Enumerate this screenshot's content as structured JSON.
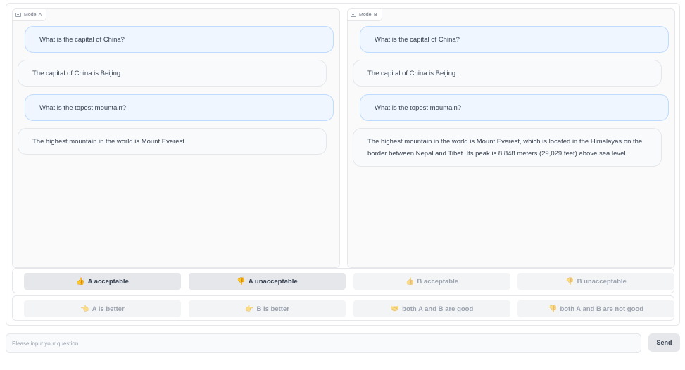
{
  "panels": {
    "a": {
      "label": "Model A",
      "messages": [
        {
          "role": "user",
          "text": "What is the capital of China?"
        },
        {
          "role": "assistant",
          "text": "The capital of China is Beijing."
        },
        {
          "role": "user",
          "text": "What is the topest mountain?"
        },
        {
          "role": "assistant",
          "text": "The highest mountain in the world is Mount Everest."
        }
      ]
    },
    "b": {
      "label": "Model B",
      "messages": [
        {
          "role": "user",
          "text": "What is the capital of China?"
        },
        {
          "role": "assistant",
          "text": "The capital of China is Beijing."
        },
        {
          "role": "user",
          "text": "What is the topest mountain?"
        },
        {
          "role": "assistant",
          "text_line1": "The highest mountain in the world is Mount Everest, which is located in the Himalayas on the",
          "text_line2": "border between Nepal and Tibet. Its peak is 8,848 meters (29,029 feet) above sea level."
        }
      ]
    }
  },
  "vote_row_1": [
    {
      "icon": "👍",
      "icon_name": "thumbs-up-icon",
      "label": "A acceptable",
      "enabled": true
    },
    {
      "icon": "👎",
      "icon_name": "thumbs-down-icon",
      "label": "A unacceptable",
      "enabled": true
    },
    {
      "icon": "👍",
      "icon_name": "thumbs-up-icon",
      "label": "B acceptable",
      "enabled": false
    },
    {
      "icon": "👎",
      "icon_name": "thumbs-down-icon",
      "label": "B unacceptable",
      "enabled": false
    }
  ],
  "vote_row_2": [
    {
      "icon": "👈",
      "icon_name": "pointing-left-icon",
      "label": "A is better",
      "enabled": false
    },
    {
      "icon": "👉",
      "icon_name": "pointing-right-icon",
      "label": "B is better",
      "enabled": false
    },
    {
      "icon": "🤝",
      "icon_name": "handshake-icon",
      "label": "both A and B are good",
      "enabled": false
    },
    {
      "icon": "👎",
      "icon_name": "thumbs-down-icon",
      "label": "both A and B are not good",
      "enabled": false
    }
  ],
  "input": {
    "placeholder": "Please input your question",
    "value": ""
  },
  "send_label": "Send",
  "colors": {
    "user_bubble": "#eff6ff",
    "user_border": "#bfdbfe",
    "bot_bubble": "#f9fafb",
    "button": "#e5e7eb",
    "button_disabled": "#f3f4f6"
  }
}
